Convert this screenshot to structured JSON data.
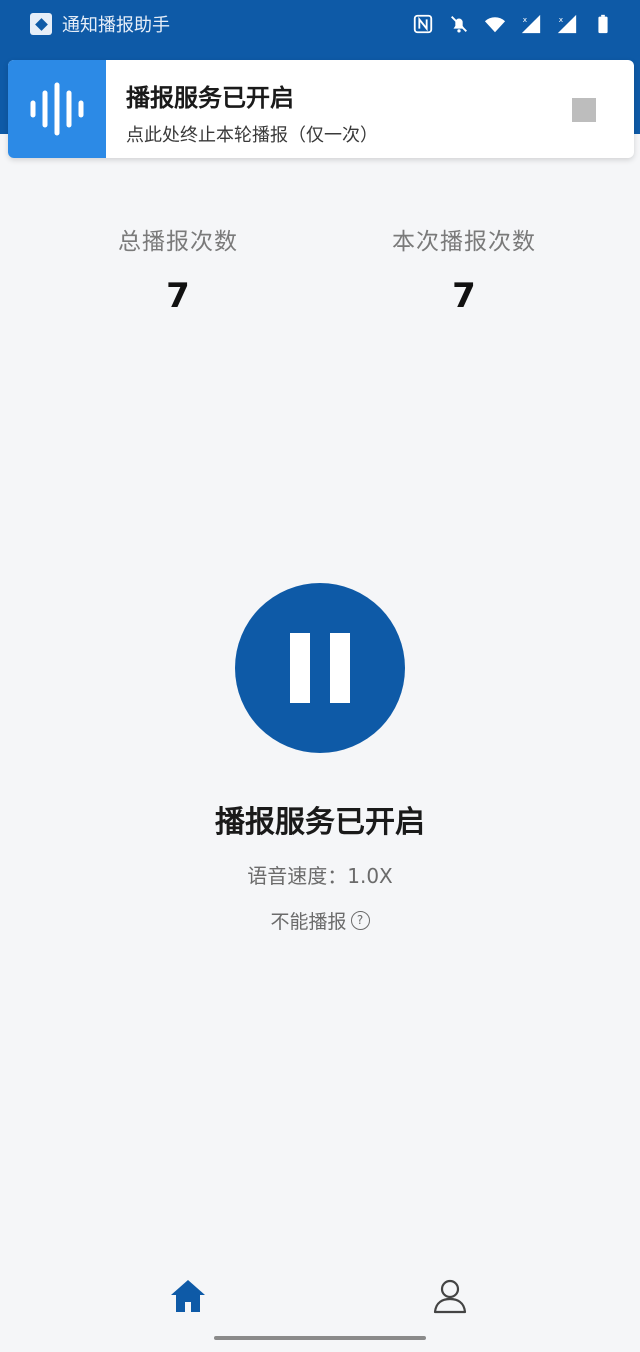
{
  "status_bar": {
    "app_label": "通知播报助手",
    "icons": [
      "nfc-icon",
      "bell-muted-icon",
      "wifi-icon",
      "signal-icon",
      "signal-icon",
      "battery-icon"
    ]
  },
  "notification": {
    "title": "播报服务已开启",
    "subtitle": "点此处终止本轮播报（仅一次）",
    "icon": "sound-wave-icon",
    "stop_icon": "stop-icon",
    "accent_color": "#2c8ae6"
  },
  "stats": {
    "total_label": "总播报次数",
    "total_value": "7",
    "current_label": "本次播报次数",
    "current_value": "7"
  },
  "control": {
    "icon": "pause-icon",
    "color": "#0e5aa7"
  },
  "service": {
    "status_text": "播报服务已开启",
    "speed_text": "语音速度：1.0X",
    "cannot_play_text": "不能播报",
    "help_glyph": "?"
  },
  "bottom_nav": {
    "items": [
      {
        "icon": "home-icon",
        "active": true
      },
      {
        "icon": "user-icon",
        "active": false
      }
    ]
  },
  "colors": {
    "primary": "#0e5aa7",
    "background": "#f5f6f8"
  }
}
